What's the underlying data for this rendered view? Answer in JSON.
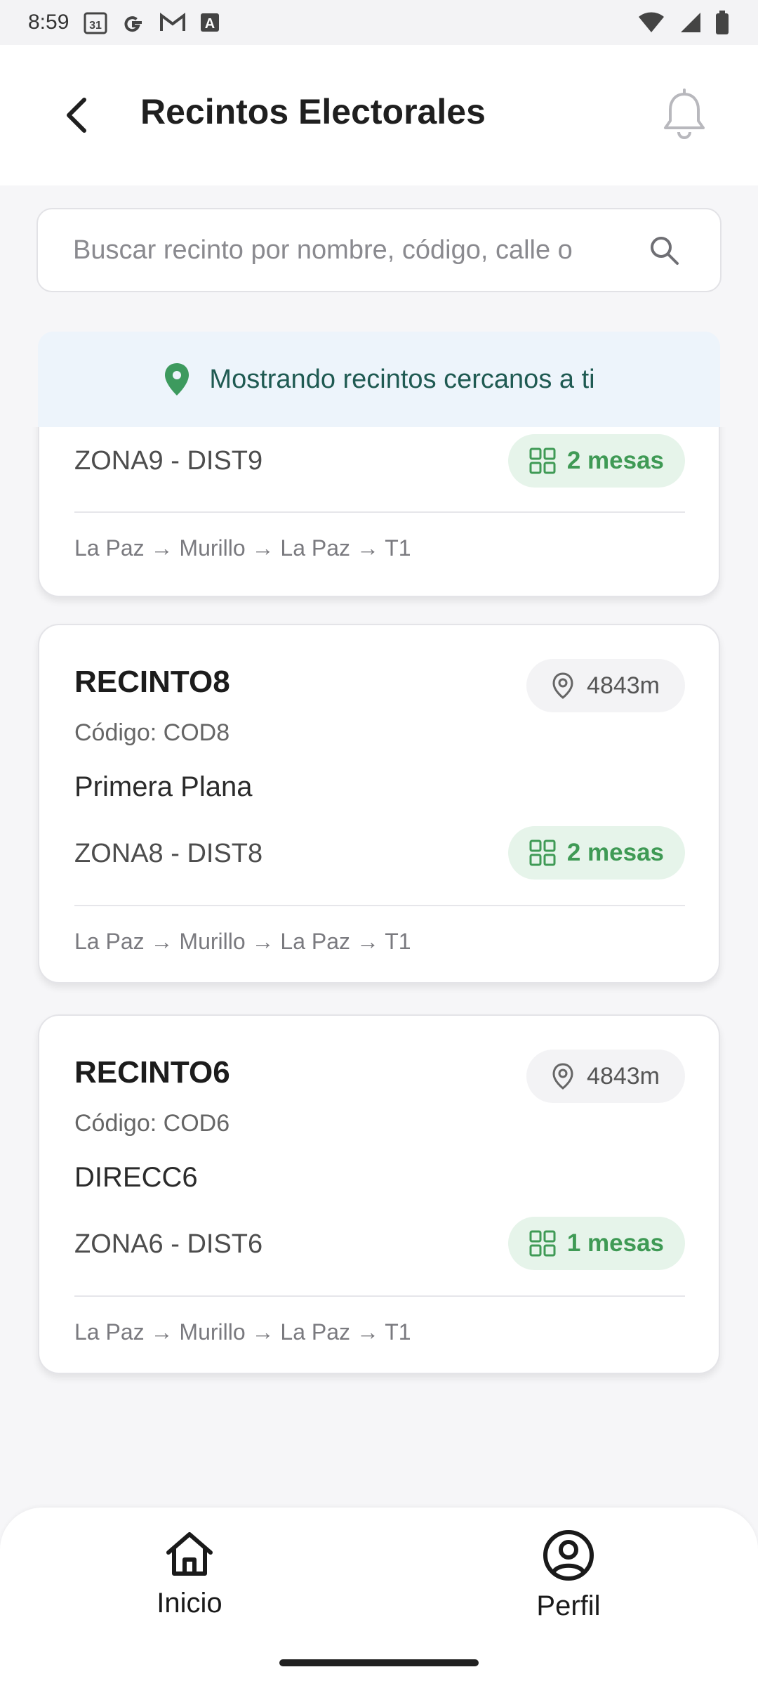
{
  "status_bar": {
    "time": "8:59",
    "icons": [
      "calendar-icon",
      "google-icon",
      "gmail-icon",
      "font-icon",
      "wifi-icon",
      "signal-icon",
      "battery-icon"
    ],
    "calendar_day": "31",
    "font_glyph": "A"
  },
  "app_bar": {
    "title": "Recintos Electorales"
  },
  "search": {
    "placeholder": "Buscar recinto por nombre, código, calle o"
  },
  "banner": {
    "text": "Mostrando recintos cercanos a ti"
  },
  "colors": {
    "accent_green": "#3f9a55",
    "banner_bg": "#edf4fb",
    "pin_green": "#3d9a5e",
    "mesas_bg": "#e6f4ea"
  },
  "cards": [
    {
      "zone": "ZONA9 - DIST9",
      "mesas": "2 mesas",
      "path": "La Paz → Murillo → La Paz → T1"
    },
    {
      "name": "RECINTO8",
      "distance": "4843m",
      "code": "Código: COD8",
      "address": "Primera Plana",
      "zone": "ZONA8 - DIST8",
      "mesas": "2 mesas",
      "path": "La Paz → Murillo → La Paz → T1"
    },
    {
      "name": "RECINTO6",
      "distance": "4843m",
      "code": "Código: COD6",
      "address": "DIRECC6",
      "zone": "ZONA6 - DIST6",
      "mesas": "1 mesas",
      "path": "La Paz → Murillo → La Paz → T1"
    }
  ],
  "bottom_nav": {
    "items": [
      {
        "label": "Inicio",
        "icon": "home-icon"
      },
      {
        "label": "Perfil",
        "icon": "profile-icon"
      }
    ]
  }
}
